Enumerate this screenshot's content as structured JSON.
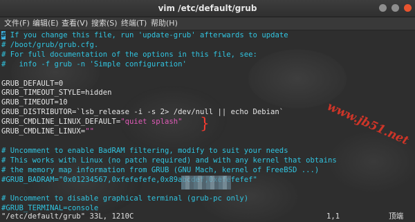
{
  "window": {
    "title": "vim /etc/default/grub"
  },
  "menubar": {
    "items": [
      "文件(F)",
      "编辑(E)",
      "查看(V)",
      "搜索(S)",
      "终端(T)",
      "帮助(H)"
    ]
  },
  "editor": {
    "cursor_char": "#",
    "lines": [
      {
        "text": " If you change this file, run 'update-grub' afterwards to update",
        "color": "#31c4e0"
      },
      {
        "text": "# /boot/grub/grub.cfg.",
        "color": "#31c4e0"
      },
      {
        "text": "# For full documentation of the options in this file, see:",
        "color": "#31c4e0"
      },
      {
        "text": "#   info -f grub -n 'Simple configuration'",
        "color": "#31c4e0"
      },
      {
        "text": "",
        "color": "#e6e6e6"
      },
      {
        "text": "GRUB_DEFAULT=0",
        "color": "#e6e6e6"
      },
      {
        "text": "GRUB_TIMEOUT_STYLE=hidden",
        "color": "#e6e6e6"
      },
      {
        "text": "GRUB_TIMEOUT=10",
        "color": "#e6e6e6"
      },
      {
        "text": "GRUB_DISTRIBUTOR=`lsb_release -i -s 2> /dev/null || echo Debian`",
        "color": "#e6e6e6"
      },
      {
        "text": "GRUB_CMDLINE_LINUX_DEFAULT=",
        "color": "#e6e6e6",
        "string": "\"quiet splash\"",
        "string_color": "#e05ab8"
      },
      {
        "text": "GRUB_CMDLINE_LINUX=",
        "color": "#e6e6e6",
        "string": "\"\"",
        "string_color": "#e05ab8"
      },
      {
        "text": "",
        "color": "#e6e6e6"
      },
      {
        "text": "# Uncomment to enable BadRAM filtering, modify to suit your needs",
        "color": "#31c4e0"
      },
      {
        "text": "# This works with Linux (no patch required) and with any kernel that obtains",
        "color": "#31c4e0"
      },
      {
        "text": "# the memory map information from GRUB (GNU Mach, kernel of FreeBSD ...)",
        "color": "#31c4e0"
      },
      {
        "text": "#GRUB_BADRAM=\"0x01234567,0xfefefefe,0x89abcdef,0xefefefef\"",
        "color": "#31c4e0"
      },
      {
        "text": "",
        "color": "#e6e6e6"
      },
      {
        "text": "# Uncomment to disable graphical terminal (grub-pc only)",
        "color": "#31c4e0"
      },
      {
        "text": "#GRUB_TERMINAL=console",
        "color": "#31c4e0"
      }
    ]
  },
  "statusbar": {
    "file_info": "\"/etc/default/grub\" 33L, 1210C",
    "position": "1,1",
    "scroll": "顶端"
  },
  "overlay": {
    "watermark": "www.jb51.net"
  },
  "colors": {
    "comment": "#31c4e0",
    "text": "#e6e6e6",
    "string": "#e05ab8",
    "cursor": "#3fb6e6",
    "annotation": "#ff3b2f"
  }
}
